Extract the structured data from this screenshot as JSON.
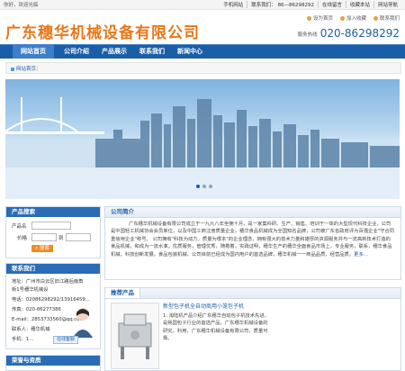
{
  "topbar": {
    "welcome": "你好，欢迎光临",
    "links": [
      "手机网站",
      "联系我们： 86—86298292",
      "在线留言",
      "收藏本站",
      "网站导航"
    ]
  },
  "header": {
    "logo_text": "广东穗华机械设备有限公司",
    "quick_links": [
      "设为首页",
      "加入收藏",
      "联系我们"
    ],
    "hotline_label": "服务热线",
    "hotline_number": "020-86298292"
  },
  "nav": {
    "items": [
      "网站首页",
      "公司介绍",
      "产品展示",
      "联系我们",
      "新闻中心"
    ],
    "active_index": 0
  },
  "crumb": {
    "text": "网站首页"
  },
  "banner": {
    "dots": 3,
    "active_dot": 0
  },
  "product_search": {
    "title": "产品搜索",
    "name_label": "产品名",
    "price_label": "价格",
    "price_to": "到",
    "search_button": "搜索"
  },
  "contact": {
    "title": "联系我们",
    "lines": [
      "地址：广州市白云区旧江路后南角",
      "街1号穗华机械设",
      "电话：02086298292/13916459...",
      "传真：020-86277386",
      "E-mail：2853733560@qq.com",
      "联系人：穗华机械",
      "手机：1..."
    ],
    "service_label": "在线客服"
  },
  "honor": {
    "title": "荣誉与资质"
  },
  "intro": {
    "title": "公司简介",
    "text": "广东穗华机械设备有限公司成立于一九九八年坐拥十月，是一家集科研、生产、销售、培训于一体的大型现代科技企业，公司是中国轻工机械协会会员单位，以及中国工商注册质量企业，穗华食品机械成为全国知名品牌，公司被广东省政府评为百强企业\"守合同重信用企业\"称号。 公司拥有\"科技为动力，质量为根本\"的企业理念，拥有强大的技术力量和雄厚的资源服务并与一流高新技术打造的食品机械，和成为一流水准，优质服务，管理优秀，随着着，实践证明，穗华生产的穗华全面食品市场上，专业服务，联系，穗华食品机械，科技创新发展，食品包装机械、公司目前已经成为国内用户的首选品牌，穗华机械一一商品品质，经营品质。",
    "more": "更多..."
  },
  "products": {
    "title": "推荐产品",
    "item_title": "新型包子机全自动商用小笼包子机",
    "item_desc": "1. 淘陆机产品介绍广东穗华自动包子机技术先进，是我国包子行业的首选产品，广东穗华机械设备的研究，利用，广东穗华机械设备有限公司，质量可靠。"
  }
}
